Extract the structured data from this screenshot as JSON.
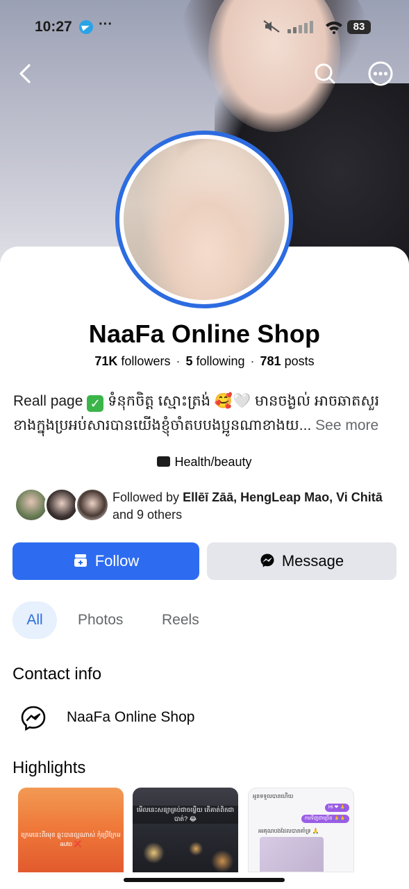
{
  "status_bar": {
    "time": "10:27",
    "more": "···",
    "battery": "83"
  },
  "header": {
    "back_icon": "chevron-left-icon",
    "search_icon": "search-icon",
    "more_icon": "more-horizontal-icon"
  },
  "profile": {
    "name": "NaaFa Online Shop",
    "followers_count": "71K",
    "followers_label": "followers",
    "following_count": "5",
    "following_label": "following",
    "posts_count": "781",
    "posts_label": "posts",
    "separator": "·",
    "bio_line1_a": "Reall page",
    "bio_line1_b": "ទំនុកចិត្ត ស្មោះត្រង់ 🥰🤍 មានចង្ងល់ អាចឆាតសួរ",
    "bio_line2": "ខាងក្នុងប្រអប់សារបានយើងខ្ញុំចាំតបបងប្អូនណាខាងយ...",
    "see_more": "See more",
    "category": "Health/beauty",
    "followed_prefix": "Followed by",
    "followed_names": "Ellēī Zāā, HengLeap Mao, Vi Chitā",
    "followed_suffix": "and 9 others"
  },
  "actions": {
    "follow_label": "Follow",
    "message_label": "Message"
  },
  "tabs": [
    {
      "label": "All"
    },
    {
      "label": "Photos"
    },
    {
      "label": "Reels"
    }
  ],
  "contact": {
    "title": "Contact info",
    "messenger_name": "NaaFa Online Shop"
  },
  "highlights": {
    "title": "Highlights",
    "items": [
      {
        "text": "ក្រេមនេះពីរមុខ ឆ្លុះ​បានល្អណាស់ កុំ​ប្រើ​ក្រែម auto ❌"
      },
      {
        "text": "មើលនេះសន្យាគ្រប់ជាចម្លើយ តើគាត់ពិតជាបាត់? 😂"
      },
      {
        "top": "អូនទទួលបានហើយ",
        "pill1": "Hi ❤ 🙏",
        "pill2": "ការ​ទិញ​ជា​ច្រើន 🙏🙏",
        "caption": "អរគុណបងដែលបានគាំទ្រ 🙏"
      }
    ]
  },
  "colors": {
    "accent": "#2d6cf0",
    "ring": "#2d6ce0",
    "tab_active_bg": "#e7f0fd",
    "secondary_button": "#e4e6eb"
  }
}
